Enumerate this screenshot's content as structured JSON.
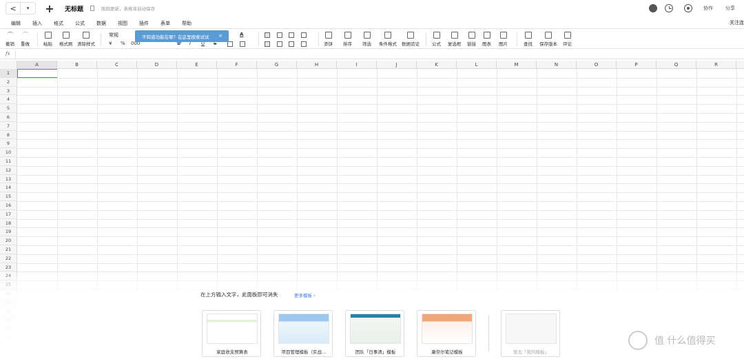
{
  "titlebar": {
    "back": "<",
    "dropdown": "▾",
    "new": "+",
    "title": "无标题",
    "save_hint": "刚刚更新，表格将自动保存",
    "collab": "协作",
    "share": "分享"
  },
  "menu": {
    "items": [
      "编辑",
      "插入",
      "格式",
      "公式",
      "数据",
      "视图",
      "插件",
      "表单",
      "帮助"
    ],
    "right": "关注连"
  },
  "toolbar": {
    "undo": "撤销",
    "redo": "重做",
    "paste": "粘贴",
    "format_painter": "格式刷",
    "clear_format": "清除样式",
    "number_format": "常规",
    "currency": "¥",
    "percent": "%",
    "thousands": "000",
    "bold": "B",
    "italic": "I",
    "underline": "U",
    "strike": "S",
    "font_color": "A",
    "filter": "添饼",
    "sort": "排序",
    "screen": "筛选",
    "cond_format": "条件格式",
    "validation": "数据验证",
    "formula": "公式",
    "checkbox": "复选框",
    "link": "链接",
    "chart": "图表",
    "image": "图片",
    "find": "查找",
    "save_version": "保存版本",
    "comment": "评论",
    "tooltip": "不知道功能在哪？在这里搜索试试",
    "tooltip_close": "×"
  },
  "formula_bar": {
    "label": "fx"
  },
  "grid": {
    "columns": [
      "A",
      "B",
      "C",
      "D",
      "E",
      "F",
      "G",
      "H",
      "I",
      "J",
      "K",
      "L",
      "M",
      "N",
      "O",
      "P",
      "Q",
      "R"
    ],
    "rows": [
      "1",
      "2",
      "3",
      "4",
      "5",
      "6",
      "7",
      "8",
      "9",
      "10",
      "11",
      "12",
      "13",
      "14",
      "15",
      "16",
      "17",
      "18",
      "19",
      "20",
      "21",
      "22",
      "23",
      "24",
      "25",
      "26",
      "27",
      "28",
      "29",
      "30",
      "31"
    ]
  },
  "template_panel": {
    "hint": "在上方输入文字，此面板即可消失",
    "more": "更多模板 ›",
    "templates": [
      "家庭收支预算表",
      "项目管理模板（实战…",
      "团队「日事清」模板",
      "康奈尔笔记模板",
      "暂无「我的模板」"
    ]
  },
  "watermark": "值 什么值得买"
}
